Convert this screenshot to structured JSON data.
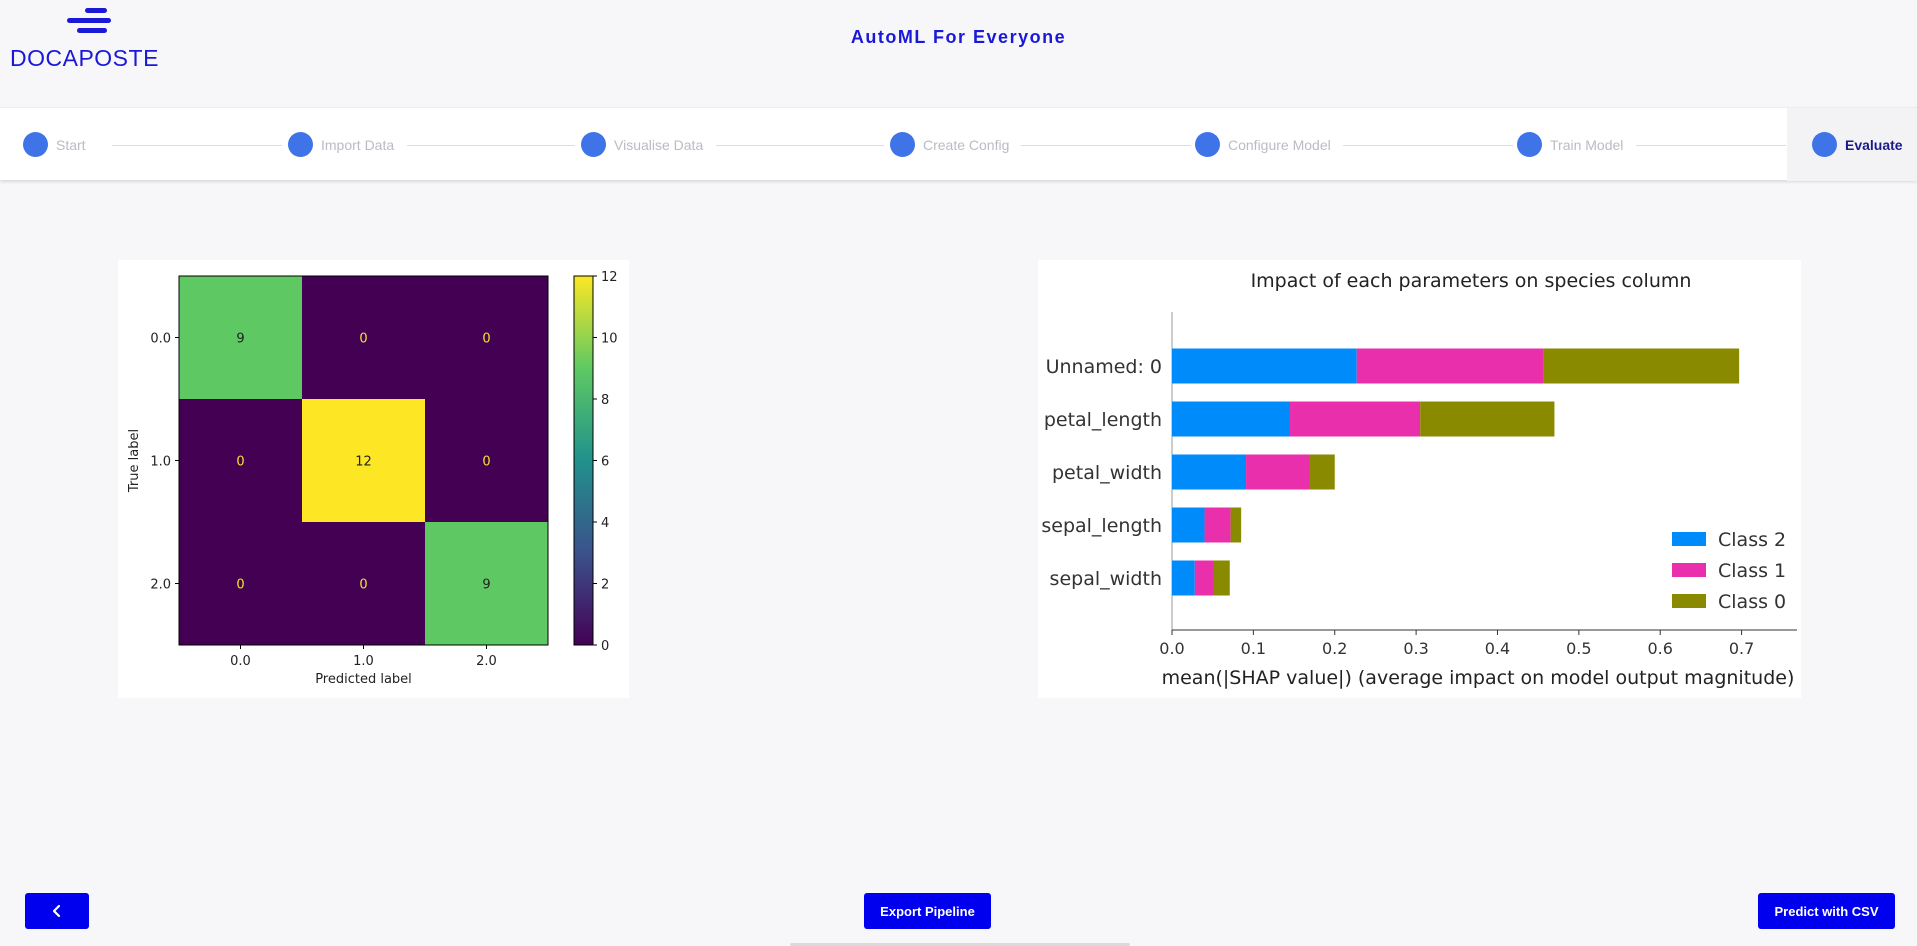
{
  "header": {
    "logo_text": "DOCAPOSTE",
    "logo_icon": "docaposte-lines-icon",
    "title": "AutoML For Everyone"
  },
  "stepper": {
    "steps": [
      {
        "label": "Start",
        "active": false
      },
      {
        "label": "Import Data",
        "active": false
      },
      {
        "label": "Visualise Data",
        "active": false
      },
      {
        "label": "Create Config",
        "active": false
      },
      {
        "label": "Configure Model",
        "active": false
      },
      {
        "label": "Train Model",
        "active": false
      },
      {
        "label": "Evaluate",
        "active": true
      }
    ],
    "dot_color": "#3f74e8"
  },
  "chart_data": [
    {
      "type": "heatmap",
      "title": "",
      "xlabel": "Predicted label",
      "ylabel": "True label",
      "x_ticks": [
        "0.0",
        "1.0",
        "2.0"
      ],
      "y_ticks": [
        "0.0",
        "1.0",
        "2.0"
      ],
      "matrix": [
        [
          9,
          0,
          0
        ],
        [
          0,
          12,
          0
        ],
        [
          0,
          0,
          9
        ]
      ],
      "colorbar_ticks": [
        "0",
        "2",
        "4",
        "6",
        "8",
        "10",
        "12"
      ],
      "colorbar_range": [
        0,
        12
      ],
      "colormap": "viridis"
    },
    {
      "type": "bar",
      "orientation": "horizontal",
      "stacked": true,
      "title": "Impact of each parameters on species column",
      "xlabel": "mean(|SHAP value|) (average impact on model output magnitude)",
      "ylabel": "",
      "categories": [
        "Unnamed: 0",
        "petal_length",
        "petal_width",
        "sepal_length",
        "sepal_width"
      ],
      "series": [
        {
          "name": "Class 2",
          "color": "#008bfb",
          "values": [
            0.227,
            0.145,
            0.091,
            0.04,
            0.028
          ]
        },
        {
          "name": "Class 1",
          "color": "#ea2fac",
          "values": [
            0.23,
            0.16,
            0.078,
            0.032,
            0.023
          ]
        },
        {
          "name": "Class 0",
          "color": "#8a8a00",
          "values": [
            0.24,
            0.165,
            0.031,
            0.013,
            0.02
          ]
        }
      ],
      "x_ticks": [
        "0.0",
        "0.1",
        "0.2",
        "0.3",
        "0.4",
        "0.5",
        "0.6",
        "0.7"
      ],
      "xlim": [
        0,
        0.73
      ],
      "legend_order": [
        "Class 2",
        "Class 1",
        "Class 0"
      ],
      "legend_position": "lower-right"
    }
  ],
  "footer": {
    "back_icon": "chevron-left-icon",
    "export_label": "Export Pipeline",
    "predict_label": "Predict with CSV"
  }
}
